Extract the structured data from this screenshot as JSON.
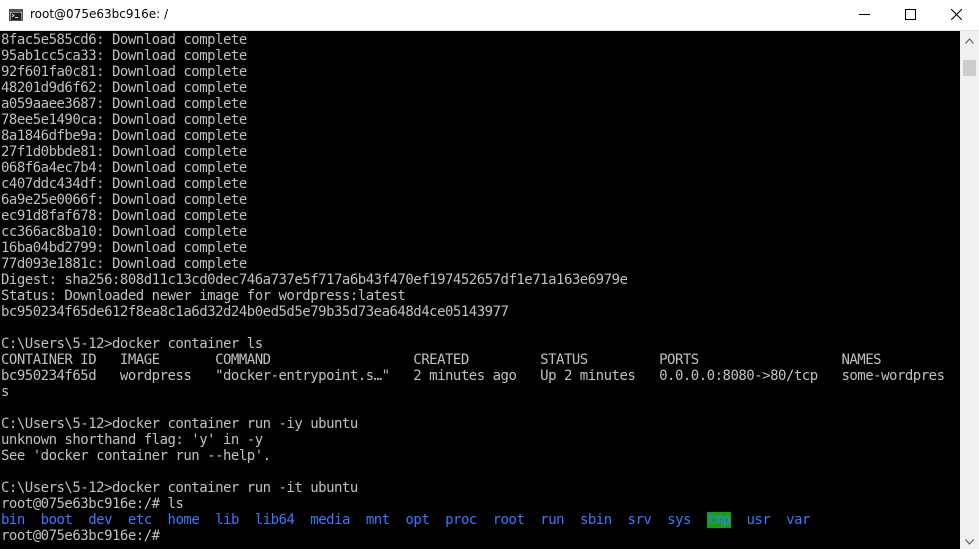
{
  "window": {
    "title": "root@075e63bc916e: /",
    "icon": "console-icon"
  },
  "controls": {
    "minimize_icon": "minimize-icon",
    "maximize_icon": "maximize-icon",
    "close_icon": "close-icon"
  },
  "terminal": {
    "download_lines": [
      "8fac5e585cd6: Download complete",
      "95ab1cc5ca33: Download complete",
      "92f601fa0c81: Download complete",
      "48201d9d6f62: Download complete",
      "a059aaee3687: Download complete",
      "78ee5e1490ca: Download complete",
      "8a1846dfbe9a: Download complete",
      "27f1d0bbde81: Download complete",
      "068f6a4ec7b4: Download complete",
      "c407ddc434df: Download complete",
      "6a9e25e0066f: Download complete",
      "ec91d8faf678: Download complete",
      "cc366ac8ba10: Download complete",
      "16ba04bd2799: Download complete",
      "77d093e1881c: Download complete"
    ],
    "digest": "Digest: sha256:808d11c13cd0dec746a737e5f717a6b43f470ef197452657df1e71a163e6979e",
    "status": "Status: Downloaded newer image for wordpress:latest",
    "container_hash": "bc950234f65de612f8ea8c1a6d32d24b0ed5d5e79b35d73ea648d4ce05143977",
    "blank": "",
    "cmd_ls": "C:\\Users\\5-12>docker container ls",
    "table_header": "CONTAINER ID   IMAGE       COMMAND                  CREATED         STATUS         PORTS                  NAMES",
    "table_row": "bc950234f65d   wordpress   \"docker-entrypoint.s…\"   2 minutes ago   Up 2 minutes   0.0.0.0:8080->80/tcp   some-wordpres",
    "table_wrap": "s",
    "cmd_run_iy": "C:\\Users\\5-12>docker container run -iy ubuntu",
    "err_flag": "unknown shorthand flag: 'y' in -y",
    "err_help": "See 'docker container run --help'.",
    "cmd_run_it": "C:\\Users\\5-12>docker container run -it ubuntu",
    "prompt_ls": "root@075e63bc916e:/# ls",
    "ls_output": [
      "bin",
      "boot",
      "dev",
      "etc",
      "home",
      "lib",
      "lib64",
      "media",
      "mnt",
      "opt",
      "proc",
      "root",
      "run",
      "sbin",
      "srv",
      "sys",
      "tmp",
      "usr",
      "var"
    ],
    "ls_highlighted": "tmp",
    "prompt_final": "root@075e63bc916e:/#"
  },
  "colors": {
    "terminal_bg": "#000000",
    "terminal_fg": "#c0c0c0",
    "dir_color": "#3b78ff",
    "tmp_highlight_bg": "#13a10e"
  }
}
